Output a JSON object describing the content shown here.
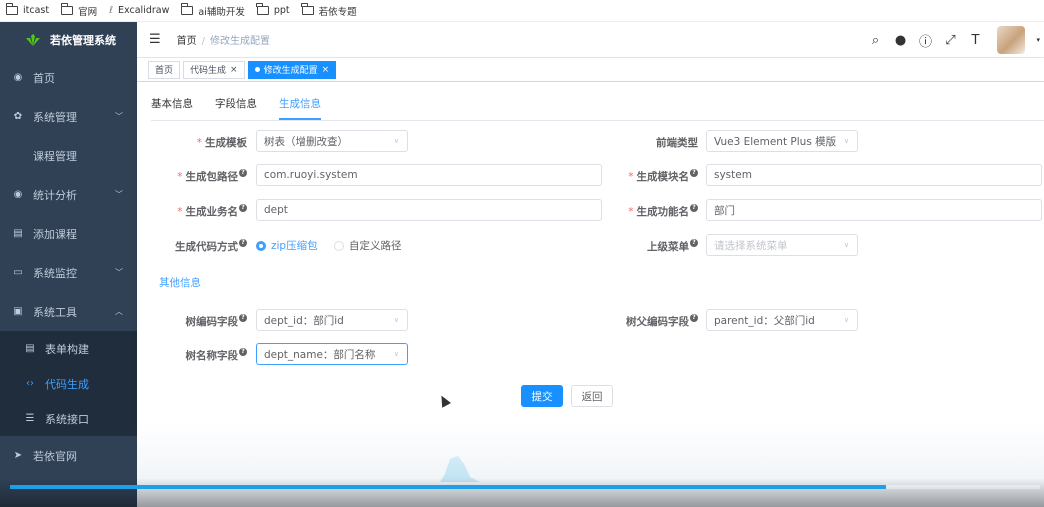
{
  "bookmarks": [
    "itcast",
    "官网",
    "Excalidraw",
    "ai辅助开发",
    "ppt",
    "若依专题"
  ],
  "app": {
    "title": "若依管理系统"
  },
  "sidebar": {
    "items": [
      {
        "label": "首页",
        "icon": "dashboard-icon",
        "type": "top"
      },
      {
        "label": "系统管理",
        "icon": "gear-icon",
        "type": "top",
        "arrow": "down"
      },
      {
        "label": "课程管理",
        "icon": "",
        "type": "plain"
      },
      {
        "label": "统计分析",
        "icon": "dashboard-icon",
        "type": "top",
        "arrow": "down"
      },
      {
        "label": "添加课程",
        "icon": "table-icon",
        "type": "top"
      },
      {
        "label": "系统监控",
        "icon": "monitor-icon",
        "type": "top",
        "arrow": "down"
      },
      {
        "label": "系统工具",
        "icon": "toolbox-icon",
        "type": "top",
        "arrow": "up"
      },
      {
        "label": "表单构建",
        "icon": "table-icon",
        "type": "sub"
      },
      {
        "label": "代码生成",
        "icon": "code-icon",
        "type": "sub",
        "active": true
      },
      {
        "label": "系统接口",
        "icon": "sliders-icon",
        "type": "sub"
      },
      {
        "label": "若依官网",
        "icon": "send-icon",
        "type": "top"
      }
    ]
  },
  "header": {
    "breadcrumb": [
      "首页",
      "修改生成配置"
    ]
  },
  "tabs": [
    "首页",
    "代码生成",
    "修改生成配置"
  ],
  "subtabs": [
    "基本信息",
    "字段信息",
    "生成信息"
  ],
  "form": {
    "template": {
      "label": "生成模板",
      "value": "树表（增删改查）"
    },
    "frontend": {
      "label": "前端类型",
      "value": "Vue3 Element Plus 模版"
    },
    "package": {
      "label": "生成包路径",
      "value": "com.ruoyi.system"
    },
    "module": {
      "label": "生成模块名",
      "value": "system"
    },
    "business": {
      "label": "生成业务名",
      "value": "dept"
    },
    "function": {
      "label": "生成功能名",
      "value": "部门"
    },
    "gentype": {
      "label": "生成代码方式",
      "opt1": "zip压缩包",
      "opt2": "自定义路径"
    },
    "parentmenu": {
      "label": "上级菜单",
      "placeholder": "请选择系统菜单"
    },
    "other": "其他信息",
    "treecode": {
      "label": "树编码字段",
      "value": "dept_id：部门id"
    },
    "treeparent": {
      "label": "树父编码字段",
      "value": "parent_id：父部门id"
    },
    "treename": {
      "label": "树名称字段",
      "value": "dept_name：部门名称"
    },
    "submit": "提交",
    "back": "返回"
  },
  "video": {
    "progress": 0.85
  },
  "colors": {
    "accent": "#409eff",
    "sidebar": "#304156",
    "primary": "#1890ff"
  }
}
